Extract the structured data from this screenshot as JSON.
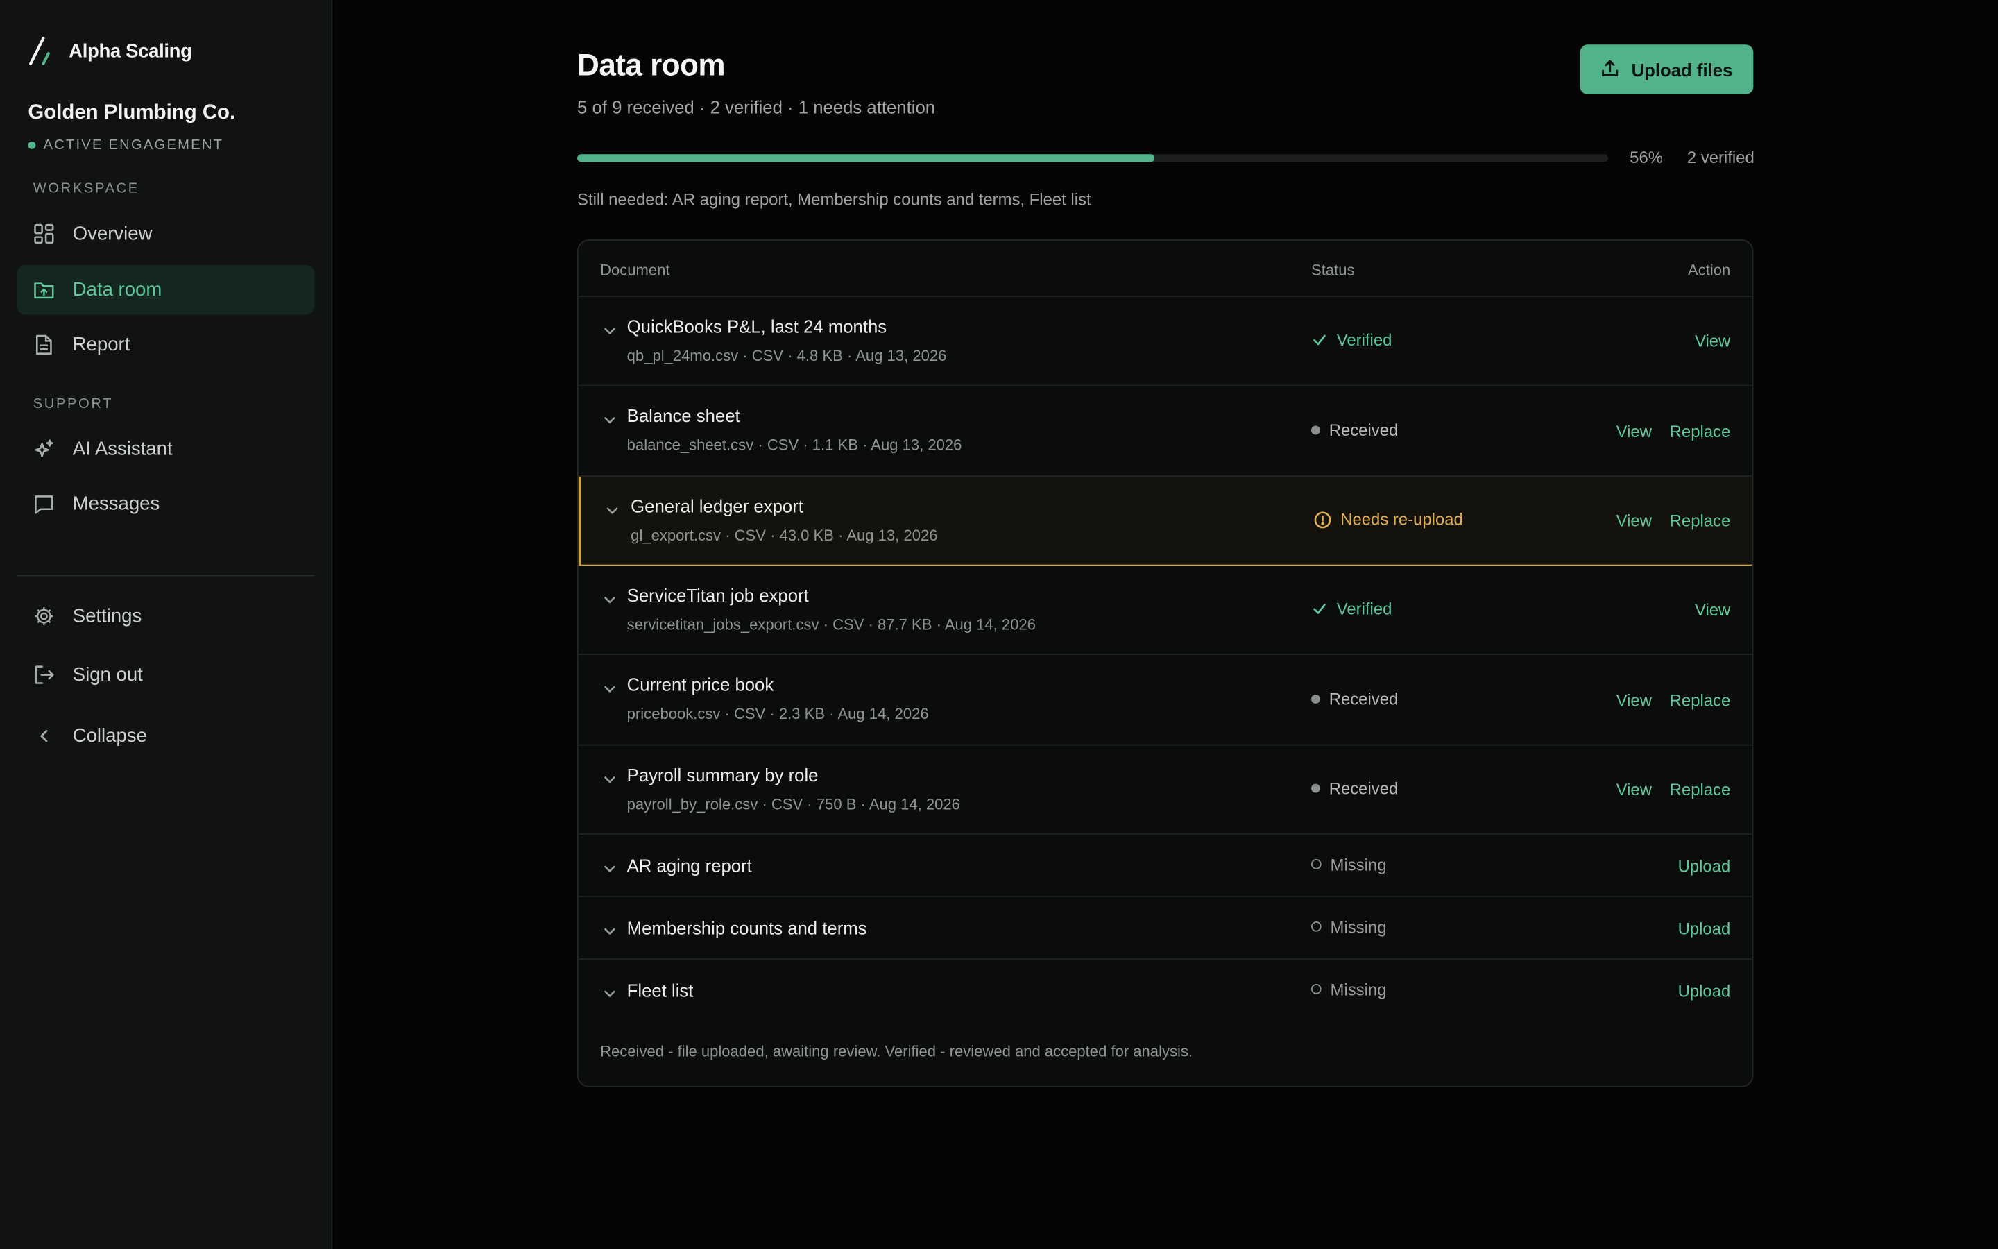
{
  "brand": {
    "name": "Alpha Scaling"
  },
  "org": {
    "name": "Golden Plumbing Co.",
    "status": "ACTIVE ENGAGEMENT"
  },
  "sidebar": {
    "workspace_label": "WORKSPACE",
    "support_label": "SUPPORT",
    "items": [
      {
        "label": "Overview",
        "icon": "grid-icon"
      },
      {
        "label": "Data room",
        "icon": "folder-upload-icon",
        "active": true
      },
      {
        "label": "Report",
        "icon": "document-icon"
      },
      {
        "label": "AI Assistant",
        "icon": "sparkles-icon"
      },
      {
        "label": "Messages",
        "icon": "chat-icon"
      }
    ],
    "bottom": [
      {
        "label": "Settings",
        "icon": "gear-icon"
      },
      {
        "label": "Sign out",
        "icon": "sign-out-icon"
      },
      {
        "label": "Collapse",
        "icon": "chevron-left-icon"
      }
    ]
  },
  "header": {
    "title": "Data room",
    "subtitle": "5 of 9 received · 2 verified · 1 needs attention",
    "upload_label": "Upload files"
  },
  "progress": {
    "value": 0.56,
    "percent_label": "56%",
    "verified_label": "2 verified"
  },
  "still_needed": "Still needed: AR aging report, Membership counts and terms, Fleet list",
  "table": {
    "columns": {
      "document": "Document",
      "status": "Status",
      "action": "Action"
    },
    "rows": [
      {
        "title": "QuickBooks P&L, last 24 months",
        "meta": "qb_pl_24mo.csv · CSV · 4.8 KB · Aug 13, 2026",
        "status": "Verified",
        "kind": "verified",
        "actions": [
          "View"
        ]
      },
      {
        "title": "Balance sheet",
        "meta": "balance_sheet.csv · CSV · 1.1 KB · Aug 13, 2026",
        "status": "Received",
        "kind": "received",
        "actions": [
          "View",
          "Replace"
        ]
      },
      {
        "title": "General ledger export",
        "meta": "gl_export.csv · CSV · 43.0 KB · Aug 13, 2026",
        "status": "Needs re-upload",
        "kind": "needs",
        "actions": [
          "View",
          "Replace"
        ]
      },
      {
        "title": "ServiceTitan job export",
        "meta": "servicetitan_jobs_export.csv · CSV · 87.7 KB · Aug 14, 2026",
        "status": "Verified",
        "kind": "verified",
        "actions": [
          "View"
        ]
      },
      {
        "title": "Current price book",
        "meta": "pricebook.csv · CSV · 2.3 KB · Aug 14, 2026",
        "status": "Received",
        "kind": "received",
        "actions": [
          "View",
          "Replace"
        ]
      },
      {
        "title": "Payroll summary by role",
        "meta": "payroll_by_role.csv · CSV · 750 B · Aug 14, 2026",
        "status": "Received",
        "kind": "received",
        "actions": [
          "View",
          "Replace"
        ]
      },
      {
        "title": "AR aging report",
        "meta": "",
        "status": "Missing",
        "kind": "missing",
        "actions": [
          "Upload"
        ]
      },
      {
        "title": "Membership counts and terms",
        "meta": "",
        "status": "Missing",
        "kind": "missing",
        "actions": [
          "Upload"
        ]
      },
      {
        "title": "Fleet list",
        "meta": "",
        "status": "Missing",
        "kind": "missing",
        "actions": [
          "Upload"
        ]
      }
    ],
    "legend": "Received - file uploaded, awaiting review. Verified - reviewed and accepted for analysis."
  },
  "colors": {
    "accent": "#52b38a",
    "warning": "#e0ad55",
    "background": "#050505",
    "sidebar": "#101312"
  }
}
